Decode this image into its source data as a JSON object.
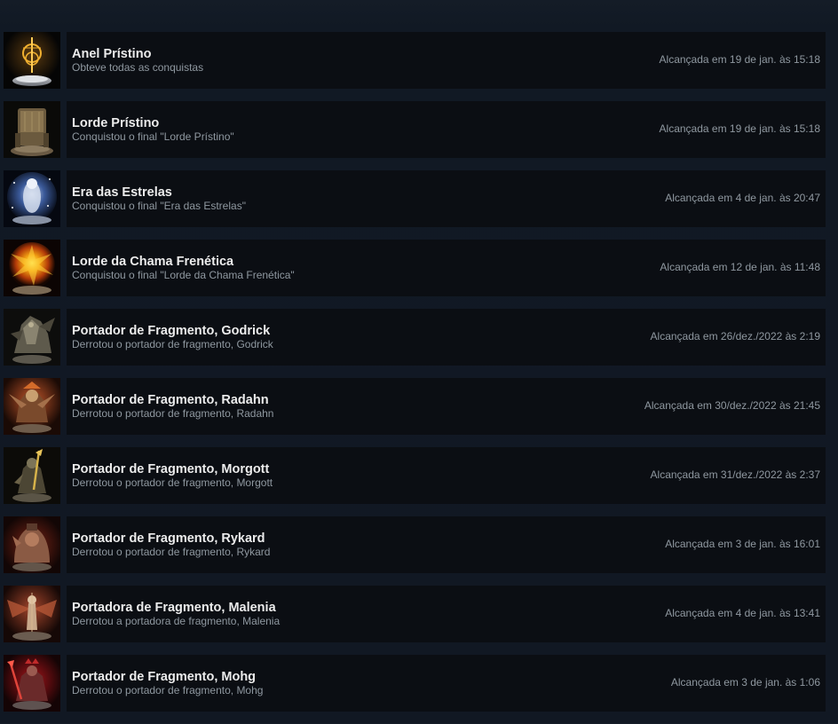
{
  "achievements": [
    {
      "title": "Anel Prístino",
      "description": "Obteve todas as conquistas",
      "unlocked": "Alcançada em 19 de jan. às 15:18",
      "icon": "elden-ring-icon"
    },
    {
      "title": "Lorde Prístino",
      "description": "Conquistou o final \"Lorde Prístino\"",
      "unlocked": "Alcançada em 19 de jan. às 15:18",
      "icon": "throne-icon"
    },
    {
      "title": "Era das Estrelas",
      "description": "Conquistou o final \"Era das Estrelas\"",
      "unlocked": "Alcançada em 4 de jan. às 20:47",
      "icon": "stars-icon"
    },
    {
      "title": "Lorde da Chama Frenética",
      "description": "Conquistou o final \"Lorde da Chama Frenética\"",
      "unlocked": "Alcançada em 12 de jan. às 11:48",
      "icon": "frenzied-flame-icon"
    },
    {
      "title": "Portador de Fragmento, Godrick",
      "description": "Derrotou o portador de fragmento, Godrick",
      "unlocked": "Alcançada em 26/dez./2022 às 2:19",
      "icon": "godrick-icon"
    },
    {
      "title": "Portador de Fragmento, Radahn",
      "description": "Derrotou o portador de fragmento, Radahn",
      "unlocked": "Alcançada em 30/dez./2022 às 21:45",
      "icon": "radahn-icon"
    },
    {
      "title": "Portador de Fragmento, Morgott",
      "description": "Derrotou o portador de fragmento, Morgott",
      "unlocked": "Alcançada em 31/dez./2022 às 2:37",
      "icon": "morgott-icon"
    },
    {
      "title": "Portador de Fragmento, Rykard",
      "description": "Derrotou o portador de fragmento, Rykard",
      "unlocked": "Alcançada em 3 de jan. às 16:01",
      "icon": "rykard-icon"
    },
    {
      "title": "Portadora de Fragmento, Malenia",
      "description": "Derrotou a portadora de fragmento, Malenia",
      "unlocked": "Alcançada em 4 de jan. às 13:41",
      "icon": "malenia-icon"
    },
    {
      "title": "Portador de Fragmento, Mohg",
      "description": "Derrotou o portador de fragmento, Mohg",
      "unlocked": "Alcançada em 3 de jan. às 1:06",
      "icon": "mohg-icon"
    }
  ]
}
